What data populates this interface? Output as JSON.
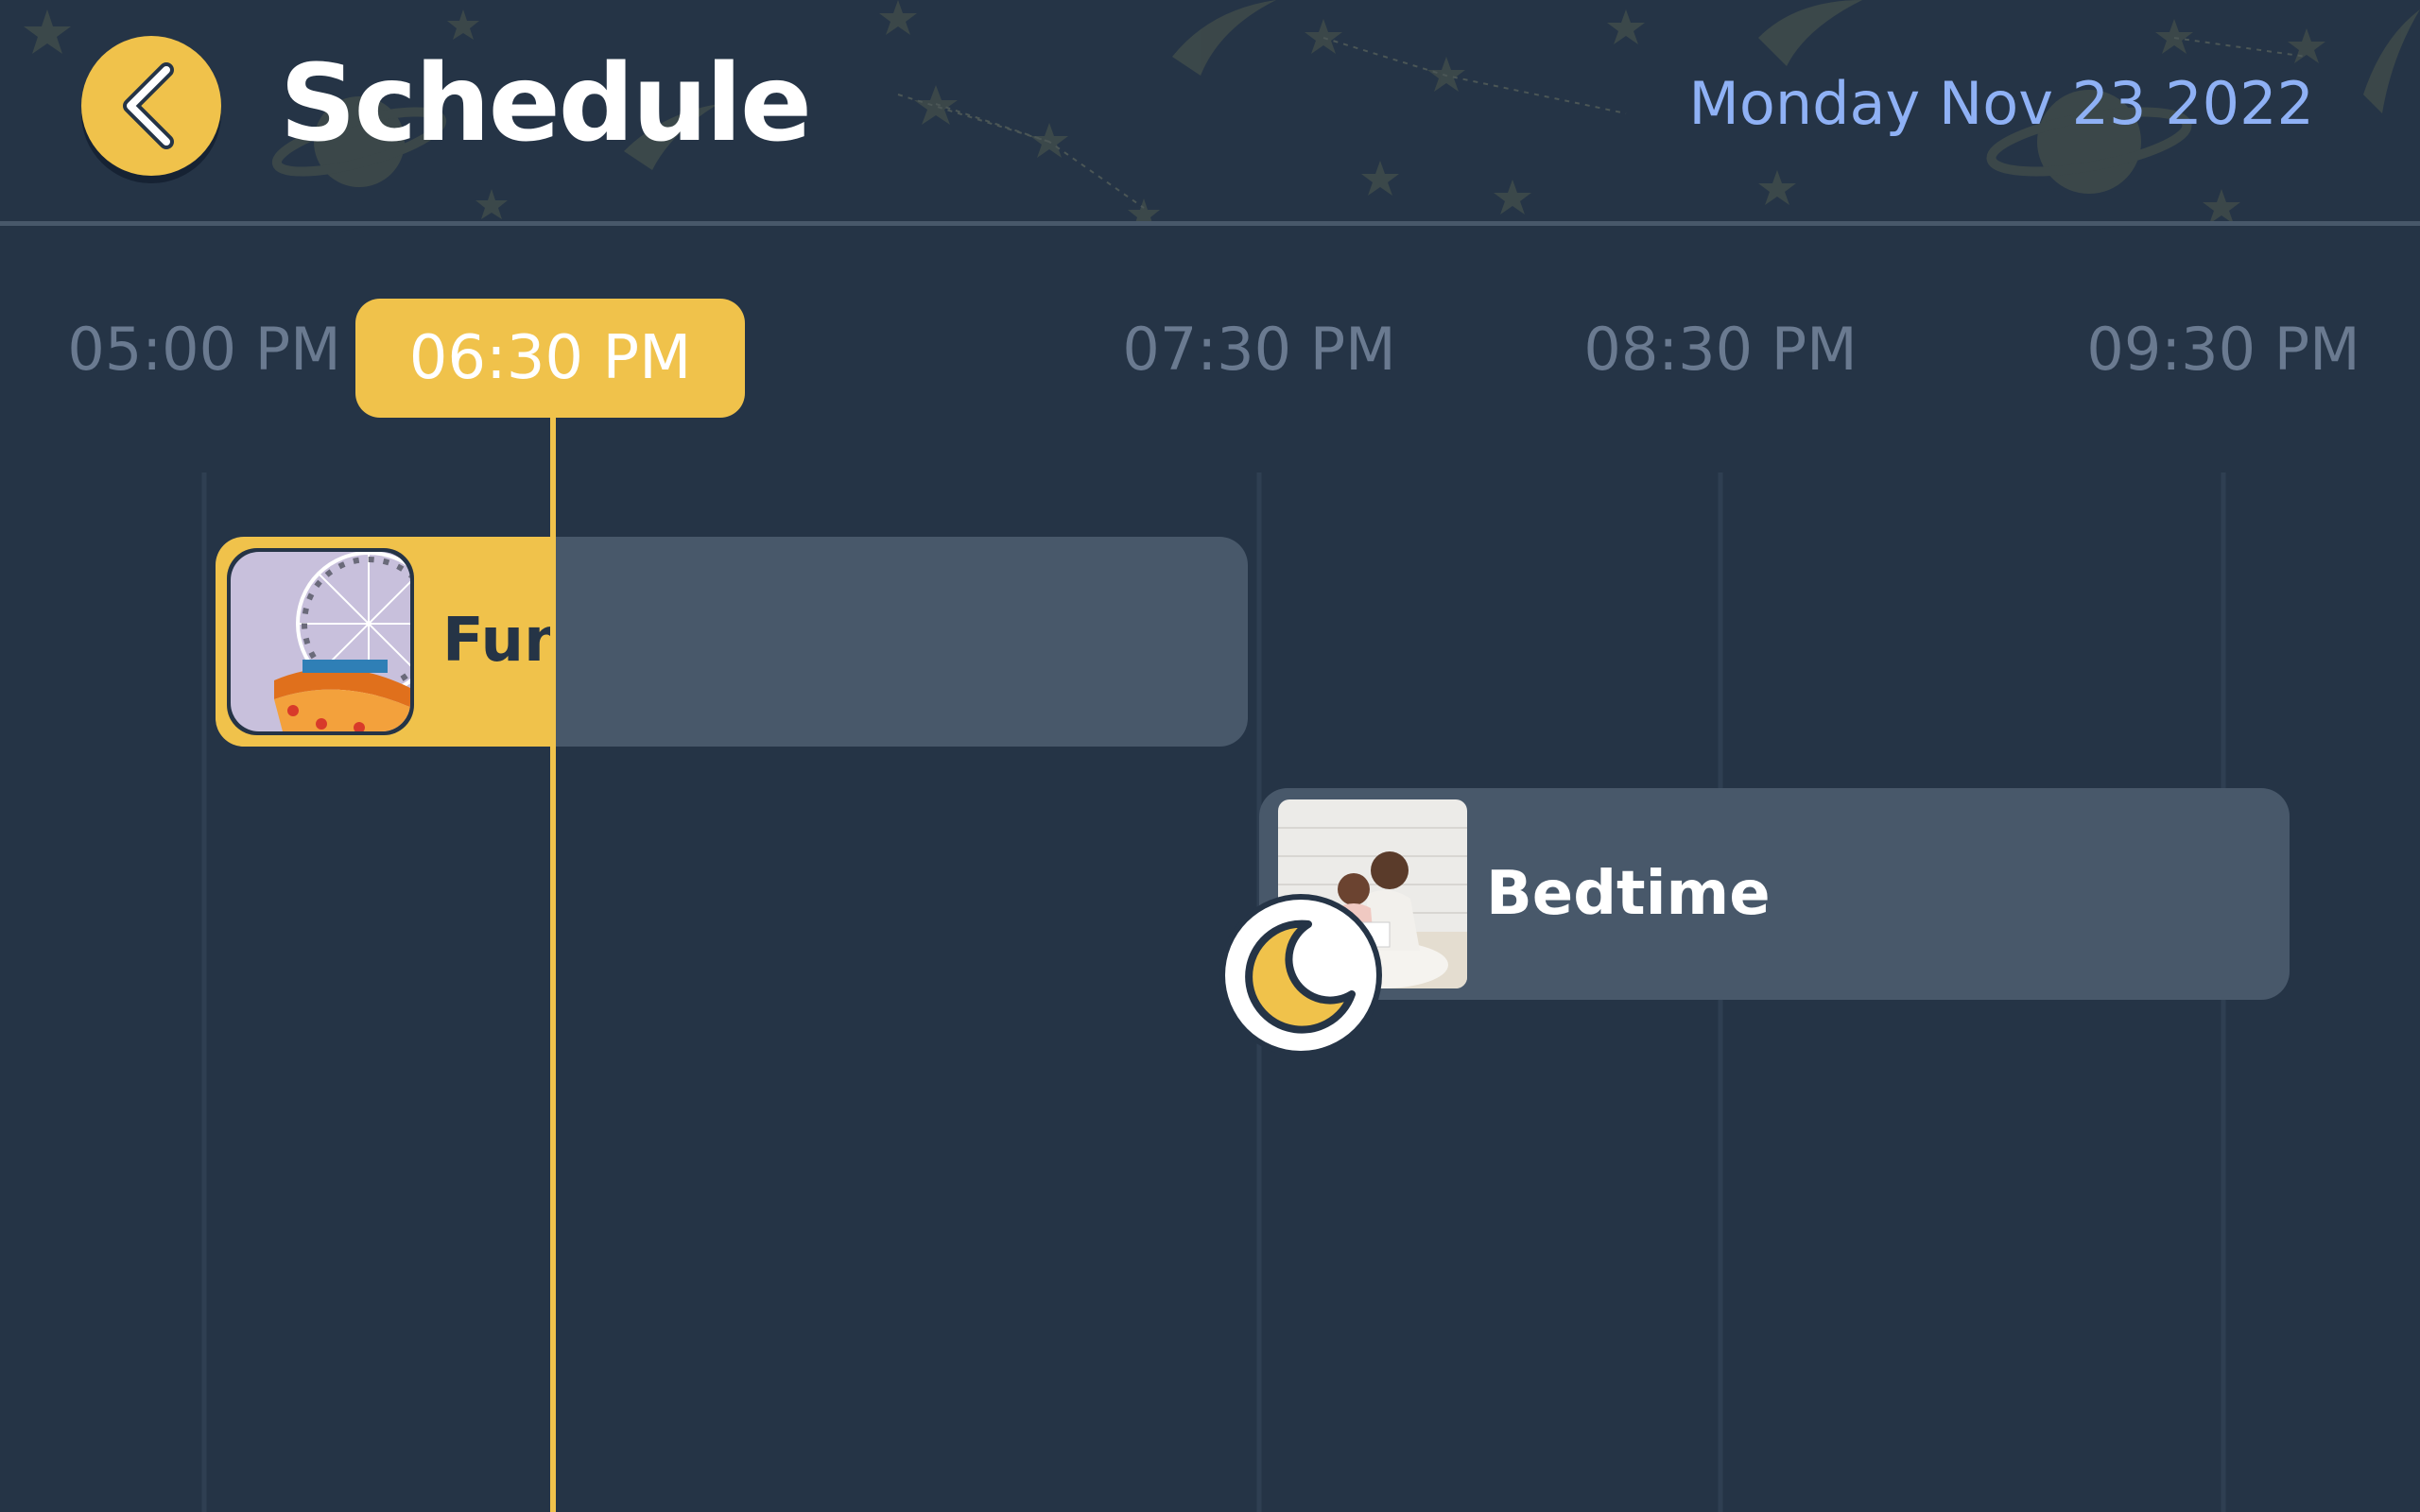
{
  "header": {
    "title": "Schedule",
    "date": "Monday Nov 23 2022"
  },
  "timeline": {
    "current_time": "06:30 PM",
    "ticks": [
      "05:00 PM",
      "07:30 PM",
      "08:30 PM",
      "09:30 PM"
    ]
  },
  "events": [
    {
      "name": "Fun",
      "thumbnail": "ferris-wheel-carnival",
      "progress": 0.33,
      "state": "in-progress"
    },
    {
      "name": "Bedtime",
      "thumbnail": "mother-daughter-reading",
      "badge_icon": "moon-icon",
      "state": "upcoming"
    }
  ],
  "colors": {
    "background": "#253446",
    "accent": "#f0c24b",
    "event_card": "#48586a",
    "date_text": "#8fb1f5",
    "tick_text": "#6a7a90"
  }
}
